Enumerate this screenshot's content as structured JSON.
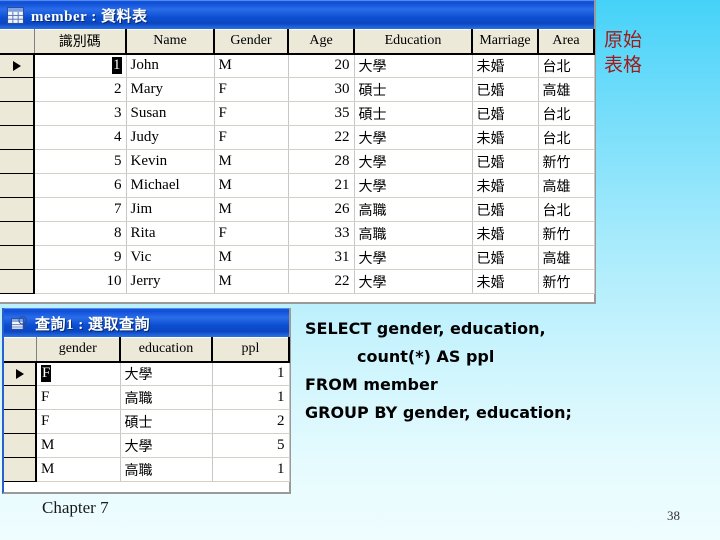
{
  "slide": {
    "background_top_color": "#45d2f8",
    "background_bottom_color": "#effdff"
  },
  "member_window": {
    "title": "member : 資料表",
    "icon": "table-icon",
    "columns": [
      "識別碼",
      "Name",
      "Gender",
      "Age",
      "Education",
      "Marriage",
      "Area"
    ],
    "rows": [
      {
        "id": "1",
        "name": "John",
        "gender": "M",
        "age": "20",
        "education": "大學",
        "marriage": "未婚",
        "area": "台北",
        "current": true,
        "id_selected": true
      },
      {
        "id": "2",
        "name": "Mary",
        "gender": "F",
        "age": "30",
        "education": "碩士",
        "marriage": "已婚",
        "area": "高雄",
        "current": false,
        "id_selected": false
      },
      {
        "id": "3",
        "name": "Susan",
        "gender": "F",
        "age": "35",
        "education": "碩士",
        "marriage": "已婚",
        "area": "台北",
        "current": false,
        "id_selected": false
      },
      {
        "id": "4",
        "name": "Judy",
        "gender": "F",
        "age": "22",
        "education": "大學",
        "marriage": "未婚",
        "area": "台北",
        "current": false,
        "id_selected": false
      },
      {
        "id": "5",
        "name": "Kevin",
        "gender": "M",
        "age": "28",
        "education": "大學",
        "marriage": "已婚",
        "area": "新竹",
        "current": false,
        "id_selected": false
      },
      {
        "id": "6",
        "name": "Michael",
        "gender": "M",
        "age": "21",
        "education": "大學",
        "marriage": "未婚",
        "area": "高雄",
        "current": false,
        "id_selected": false
      },
      {
        "id": "7",
        "name": "Jim",
        "gender": "M",
        "age": "26",
        "education": "高職",
        "marriage": "已婚",
        "area": "台北",
        "current": false,
        "id_selected": false
      },
      {
        "id": "8",
        "name": "Rita",
        "gender": "F",
        "age": "33",
        "education": "高職",
        "marriage": "未婚",
        "area": "新竹",
        "current": false,
        "id_selected": false
      },
      {
        "id": "9",
        "name": "Vic",
        "gender": "M",
        "age": "31",
        "education": "大學",
        "marriage": "已婚",
        "area": "高雄",
        "current": false,
        "id_selected": false
      },
      {
        "id": "10",
        "name": "Jerry",
        "gender": "M",
        "age": "22",
        "education": "大學",
        "marriage": "未婚",
        "area": "新竹",
        "current": false,
        "id_selected": false
      }
    ]
  },
  "query_window": {
    "title": "查詢1 : 選取查詢",
    "icon": "query-icon",
    "columns": [
      "gender",
      "education",
      "ppl"
    ],
    "rows": [
      {
        "gender": "F",
        "education": "大學",
        "ppl": "1",
        "current": true,
        "gender_selected": true
      },
      {
        "gender": "F",
        "education": "高職",
        "ppl": "1",
        "current": false,
        "gender_selected": false
      },
      {
        "gender": "F",
        "education": "碩士",
        "ppl": "2",
        "current": false,
        "gender_selected": false
      },
      {
        "gender": "M",
        "education": "大學",
        "ppl": "5",
        "current": false,
        "gender_selected": false
      },
      {
        "gender": "M",
        "education": "高職",
        "ppl": "1",
        "current": false,
        "gender_selected": false
      }
    ]
  },
  "annotation": {
    "line1": "原始",
    "line2": "表格",
    "color": "#9e1b1b"
  },
  "sql": {
    "line1": "SELECT gender, education,",
    "line2": "count(*) AS ppl",
    "line3": "FROM member",
    "line4": "GROUP BY gender, education;"
  },
  "footer": {
    "chapter": "Chapter 7",
    "page": "38"
  }
}
